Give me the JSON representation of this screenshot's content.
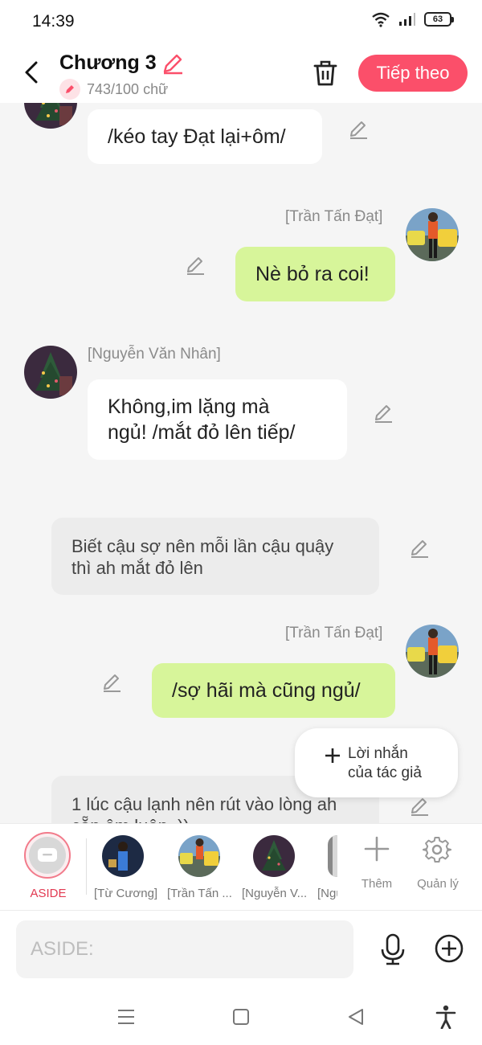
{
  "status": {
    "time": "14:39",
    "battery": "63"
  },
  "header": {
    "title": "Chương 3",
    "word_count": "743/100 chữ",
    "next_label": "Tiếp theo"
  },
  "messages": [
    {
      "type": "left",
      "text": "/kéo tay Đạt lại+ôm/"
    },
    {
      "type": "right",
      "name": "[Trần Tấn Đạt]",
      "text": "Nè bỏ ra coi!"
    },
    {
      "type": "left",
      "name": "[Nguyễn Văn Nhân]",
      "line1": "Không,im lặng mà",
      "line2": "ngủ! /mắt đỏ lên tiếp/"
    },
    {
      "type": "aside",
      "line1": "Biết cậu sợ nên mỗi lần cậu quậy",
      "line2": "thì ah mắt đỏ lên"
    },
    {
      "type": "right",
      "name": "[Trần Tấn Đạt]",
      "text": "/sợ hãi mà cũng ngủ/"
    },
    {
      "type": "aside",
      "line1": "1 lúc cậu lạnh nên rút vào lòng ah",
      "line2": "cẵn ôm luôn..))"
    }
  ],
  "author_note": {
    "line1": "Lời nhắn",
    "line2": "của tác giả"
  },
  "characters": {
    "aside_label": "ASIDE",
    "items": [
      "[Từ Cương]",
      "[Trần Tấn ...",
      "[Nguyễn V...",
      "[Ngu"
    ],
    "add_label": "Thêm",
    "manage_label": "Quản lý"
  },
  "input": {
    "placeholder": "ASIDE:"
  },
  "colors": {
    "accent": "#fb4f6a",
    "green_bubble": "#d7f59a",
    "aside_bubble": "#ececec"
  }
}
